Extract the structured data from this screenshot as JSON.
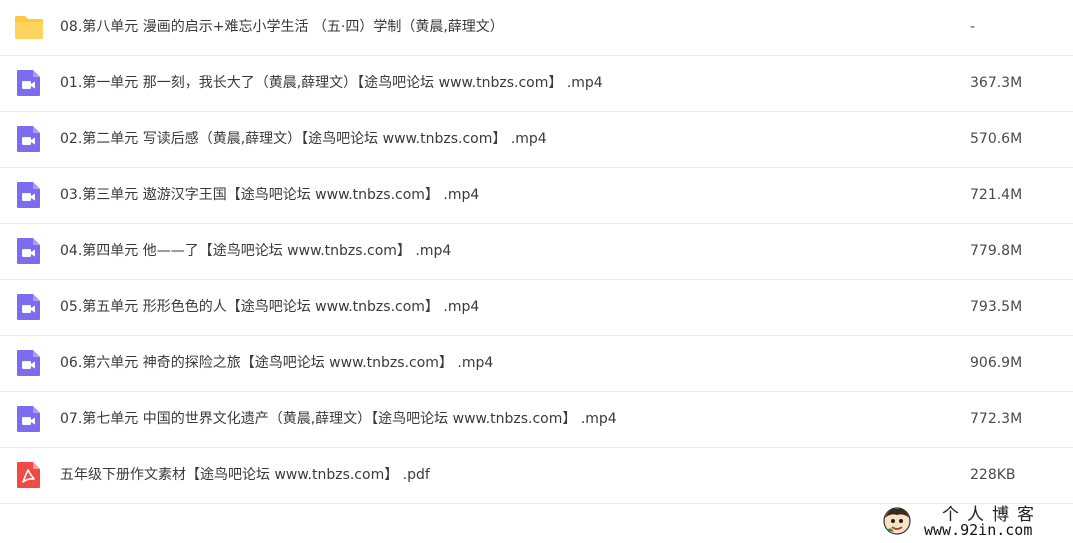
{
  "colors": {
    "folder": "#ffc83d",
    "video": "#7c6cf0",
    "pdf": "#ef4a45"
  },
  "files": [
    {
      "icon": "folder-icon",
      "type": "folder",
      "name": "08.第八单元 漫画的启示+难忘小学生活 （五·四）学制（黄晨,薛理文）",
      "size": "-"
    },
    {
      "icon": "video-icon",
      "type": "video",
      "name": "01.第一单元 那一刻，我长大了（黄晨,薛理文）【途鸟吧论坛 www.tnbzs.com】 .mp4",
      "size": "367.3M"
    },
    {
      "icon": "video-icon",
      "type": "video",
      "name": "02.第二单元 写读后感（黄晨,薛理文）【途鸟吧论坛 www.tnbzs.com】 .mp4",
      "size": "570.6M"
    },
    {
      "icon": "video-icon",
      "type": "video",
      "name": "03.第三单元 遨游汉字王国【途鸟吧论坛 www.tnbzs.com】 .mp4",
      "size": "721.4M"
    },
    {
      "icon": "video-icon",
      "type": "video",
      "name": "04.第四单元 他——了【途鸟吧论坛 www.tnbzs.com】 .mp4",
      "size": "779.8M"
    },
    {
      "icon": "video-icon",
      "type": "video",
      "name": "05.第五单元 形形色色的人【途鸟吧论坛 www.tnbzs.com】 .mp4",
      "size": "793.5M"
    },
    {
      "icon": "video-icon",
      "type": "video",
      "name": "06.第六单元 神奇的探险之旅【途鸟吧论坛 www.tnbzs.com】 .mp4",
      "size": "906.9M"
    },
    {
      "icon": "video-icon",
      "type": "video",
      "name": "07.第七单元 中国的世界文化遗产（黄晨,薛理文）【途鸟吧论坛 www.tnbzs.com】 .mp4",
      "size": "772.3M"
    },
    {
      "icon": "pdf-icon",
      "type": "pdf",
      "name": "五年级下册作文素材【途鸟吧论坛 www.tnbzs.com】 .pdf",
      "size": "228KB"
    }
  ],
  "watermark": {
    "title": "个人博客",
    "url": "www.92in.com"
  }
}
